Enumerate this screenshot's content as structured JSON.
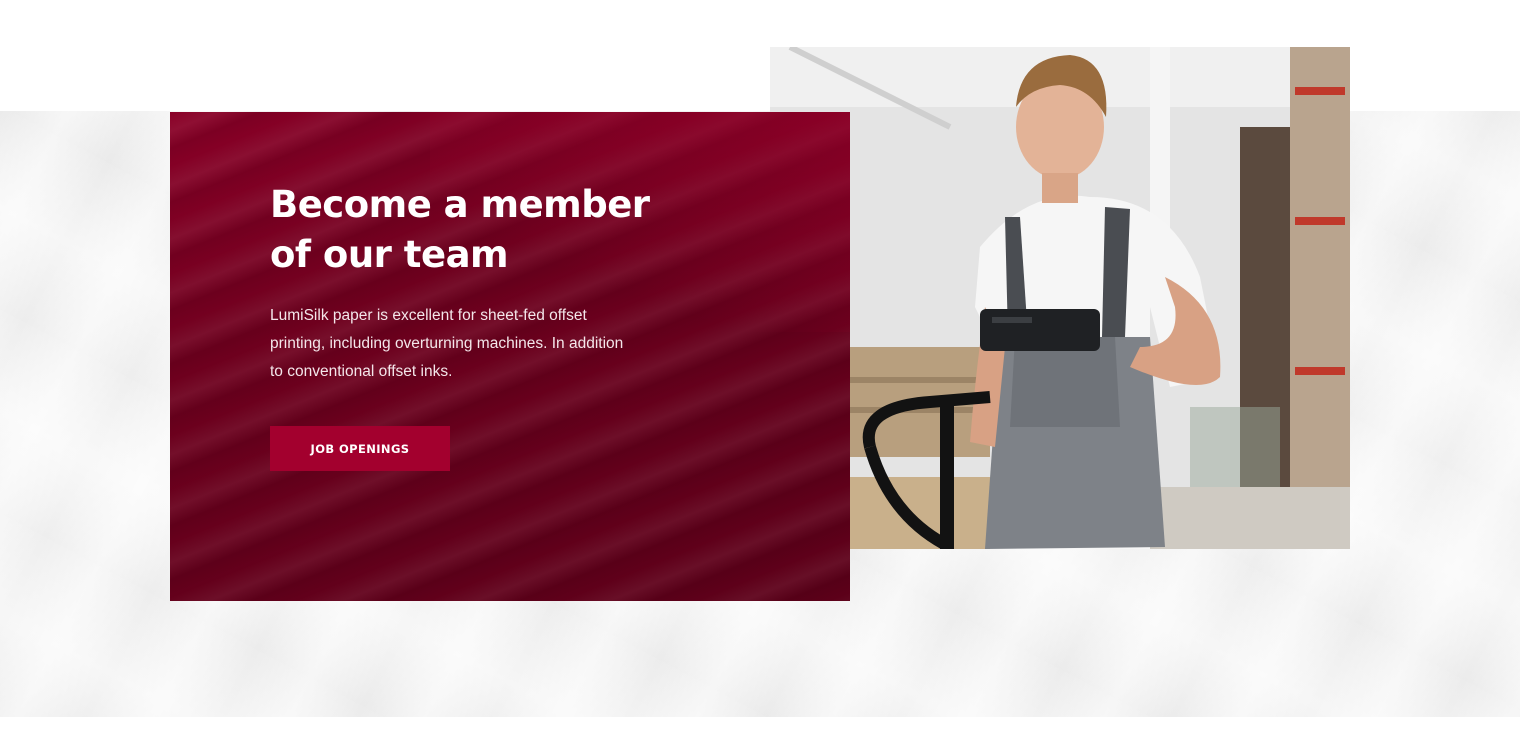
{
  "section": {
    "title_line1": "Become a member",
    "title_line2": "of our team",
    "description_line1": "LumiSilk paper is excellent for sheet-fed offset",
    "description_line2": "printing, including overturning machines. In addition",
    "description_line3": "to conventional offset inks.",
    "cta_label": "JOB OPENINGS"
  },
  "colors": {
    "card_background": "#6f001e",
    "cta_background": "#a3002e",
    "band_background": "#f0f0f0"
  }
}
